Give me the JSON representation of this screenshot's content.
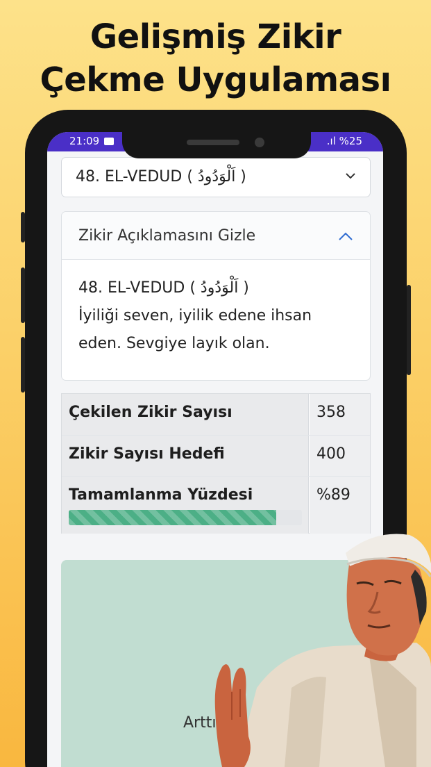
{
  "headline": {
    "line1": "Gelişmiş Zikir",
    "line2": "Çekme Uygulaması"
  },
  "statusbar": {
    "time": "21:09",
    "battery_text": ".ıl %25"
  },
  "dhikr_select": {
    "selected": "48. EL-VEDUD ( اَلْوَدُودُ )"
  },
  "description": {
    "toggle_label": "Zikir Açıklamasını Gizle",
    "name": "48. EL-VEDUD ( اَلْوَدُودُ )",
    "meaning_line1": "İyiliği seven, iyilik edene ihsan",
    "meaning_line2": "eden. Sevgiye layık olan."
  },
  "stats": {
    "count_label": "Çekilen Zikir Sayısı",
    "count_value": "358",
    "target_label": "Zikir Sayısı Hedefi",
    "target_value": "400",
    "percent_label": "Tamamlanma Yüzdesi",
    "percent_value": "%89",
    "progress_fraction": 0.89
  },
  "counter": {
    "button_label": "Arttır"
  },
  "colors": {
    "status_bar": "#4a2fc7",
    "progress": "#4caf86",
    "counter_bg": "#c1ddd1",
    "accent_chevron": "#2e6bd1"
  }
}
